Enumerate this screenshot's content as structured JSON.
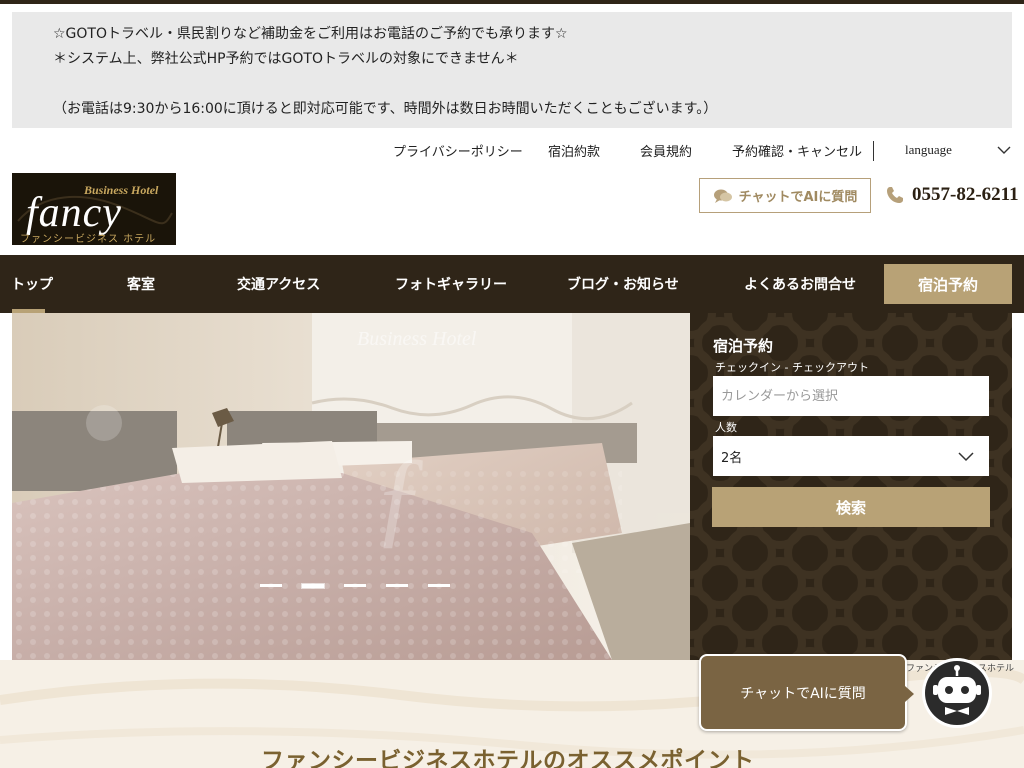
{
  "notice": {
    "line1": "☆GOTOトラベル・県民割りなど補助金をご利用はお電話のご予約でも承ります☆",
    "line2": "＊システム上、弊社公式HP予約ではGOTOトラベルの対象にできません＊",
    "line3": "（お電話は9:30から16:00に頂けると即対応可能です、時間外は数日お時間いただくこともございます。）"
  },
  "util_nav": {
    "privacy": "プライバシーポリシー",
    "terms": "宿泊約款",
    "member": "会員規約",
    "confirm": "予約確認・キャンセル",
    "language": "language"
  },
  "logo": {
    "business_hotel": "Business Hotel",
    "fancy": "fancy",
    "jp": "ファンシービジネス ホテル"
  },
  "header": {
    "chat_label": "チャットでAIに質問",
    "phone": "0557-82-6211"
  },
  "nav": {
    "items": [
      "トップ",
      "客室",
      "交通アクセス",
      "フォトギャラリー",
      "ブログ・お知らせ",
      "よくあるお問合せ"
    ],
    "reserve": "宿泊予約"
  },
  "hero": {
    "watermark": "Business Hotel",
    "slides": 5,
    "active_slide": 2
  },
  "booking": {
    "title": "宿泊予約",
    "date_label": "チェックイン - チェックアウト",
    "date_placeholder": "カレンダーから選択",
    "guests_label": "人数",
    "guests_value": "2名",
    "search": "検索"
  },
  "credit": "ファンシービジネスホテル",
  "section_title": "ファンシービジネスホテルのオススメポイント",
  "float_chat": {
    "label": "チャットでAIに質問"
  },
  "colors": {
    "dark_brown": "#2f2518",
    "gold": "#b8a276",
    "chat_brown": "#7a6443"
  }
}
